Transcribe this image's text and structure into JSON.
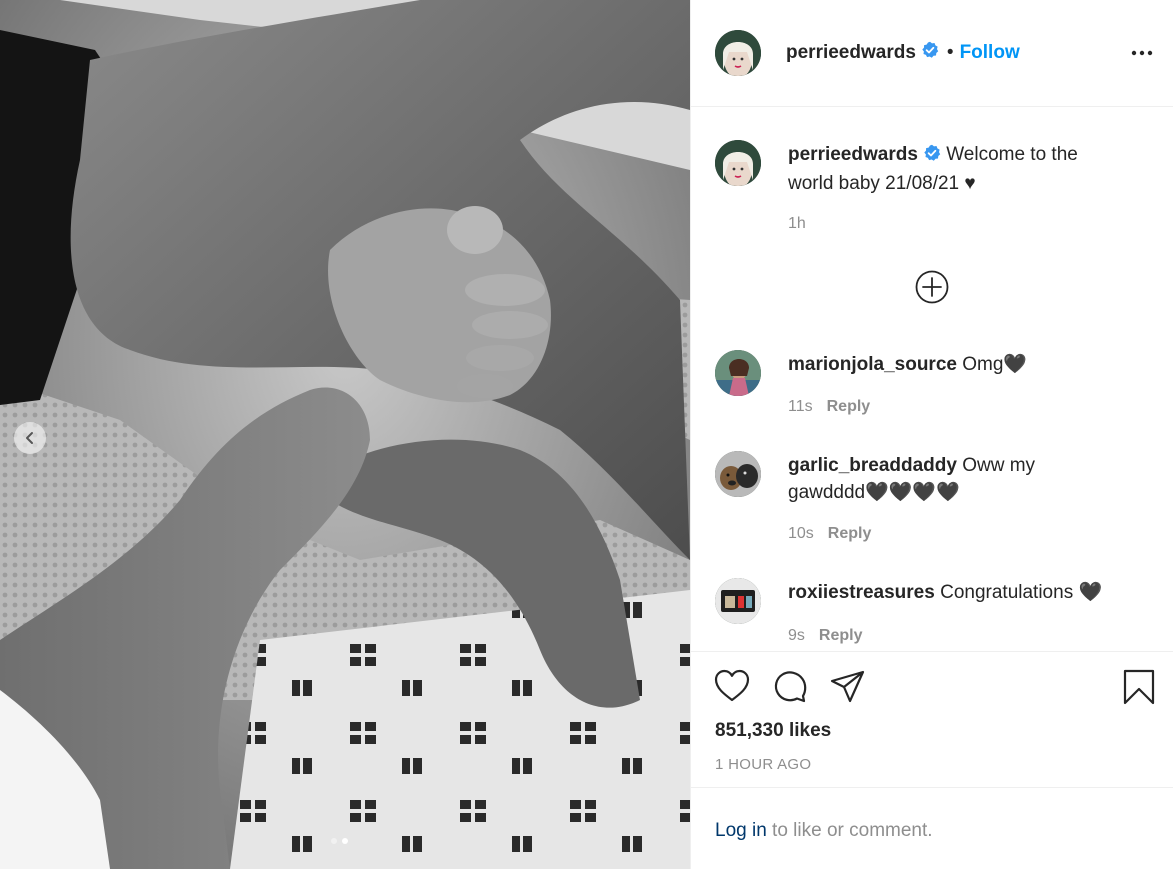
{
  "post": {
    "author": "perrieedwards",
    "follow_label": "Follow",
    "separator": "•",
    "caption_text": "Welcome to the",
    "caption_text_2": "world baby 21/08/21 ♥",
    "caption_time": "1h"
  },
  "comments": [
    {
      "user": "marionjola_source",
      "text": "Omg🖤",
      "time": "11s",
      "reply": "Reply"
    },
    {
      "user": "garlic_breaddaddy",
      "text": "Oww my",
      "text_2": "gawdddd🖤🖤🖤🖤",
      "time": "10s",
      "reply": "Reply"
    },
    {
      "user": "roxiiestreasures",
      "text": "Congratulations 🖤",
      "time": "9s",
      "reply": "Reply"
    }
  ],
  "stats": {
    "likes": "851,330 likes",
    "posted": "1 HOUR AGO"
  },
  "login": {
    "link": "Log in",
    "rest": " to like or comment."
  },
  "carousel": {
    "slide_count": 2,
    "active_slide": 2
  },
  "icons": [
    "chevron-left-icon",
    "verified-badge-icon",
    "more-options-icon",
    "add-circle-icon",
    "heart-icon",
    "comment-icon",
    "share-icon",
    "bookmark-icon"
  ],
  "colors": {
    "follow": "#0095f6",
    "verified": "#3897f0",
    "login_link": "#00376b",
    "muted": "#8e8e8e",
    "text": "#262626"
  }
}
